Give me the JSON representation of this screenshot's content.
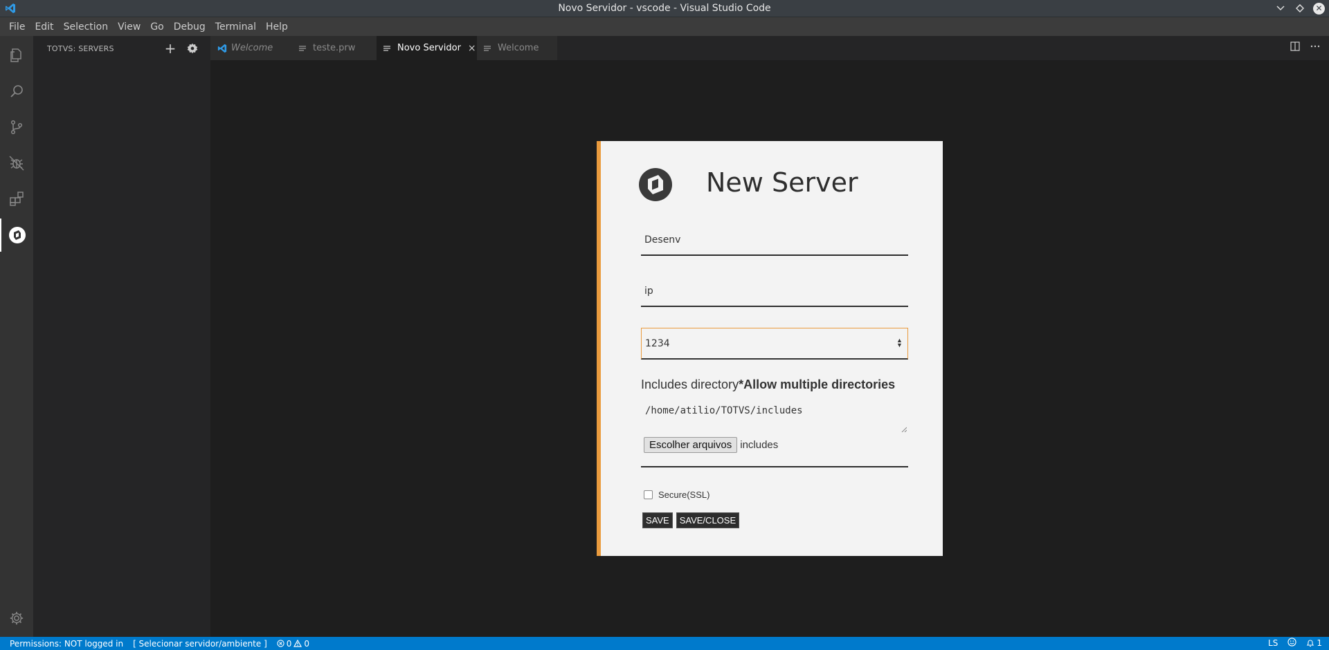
{
  "window": {
    "title": "Novo Servidor - vscode - Visual Studio Code",
    "controls": [
      "minimize",
      "maximize",
      "close"
    ]
  },
  "menu": [
    "File",
    "Edit",
    "Selection",
    "View",
    "Go",
    "Debug",
    "Terminal",
    "Help"
  ],
  "activitybar": {
    "icons": [
      "files-icon",
      "search-icon",
      "source-control-icon",
      "debug-icon",
      "extensions-icon",
      "totvs-icon",
      "manage-gear-icon"
    ],
    "active": "totvs-icon"
  },
  "sidebar": {
    "title": "TOTVS: SERVERS",
    "add_label": "+"
  },
  "tabs": [
    {
      "label": "Welcome",
      "icon": "vscode-icon",
      "italic": true,
      "active": false
    },
    {
      "label": "teste.prw",
      "icon": "lines-icon",
      "italic": false,
      "active": false
    },
    {
      "label": "Novo Servidor",
      "icon": "lines-icon",
      "italic": false,
      "active": true,
      "close": "×"
    },
    {
      "label": "Welcome",
      "icon": "lines-icon",
      "italic": false,
      "active": false
    }
  ],
  "form": {
    "heading": "New Server",
    "name_value": "Desenv",
    "ip_value": "ip",
    "port_value": "1234",
    "includes_label": "Includes directory",
    "includes_note": "*Allow multiple directories",
    "includes_value": "/home/atilio/TOTVS/includes",
    "choose_button": "Escolher arquivos",
    "choose_file": "includes",
    "ssl_label": "Secure(SSL)",
    "ssl_checked": false,
    "save_label": "SAVE",
    "save_close_label": "SAVE/CLOSE",
    "accent_color": "#ea9b3e"
  },
  "statusbar": {
    "permissions": "Permissions: NOT logged in",
    "server_select": "[ Selecionar servidor/ambiente ]",
    "errors": "0",
    "warnings": "0",
    "language": "LS",
    "notifications": "1",
    "color": "#007acc"
  }
}
